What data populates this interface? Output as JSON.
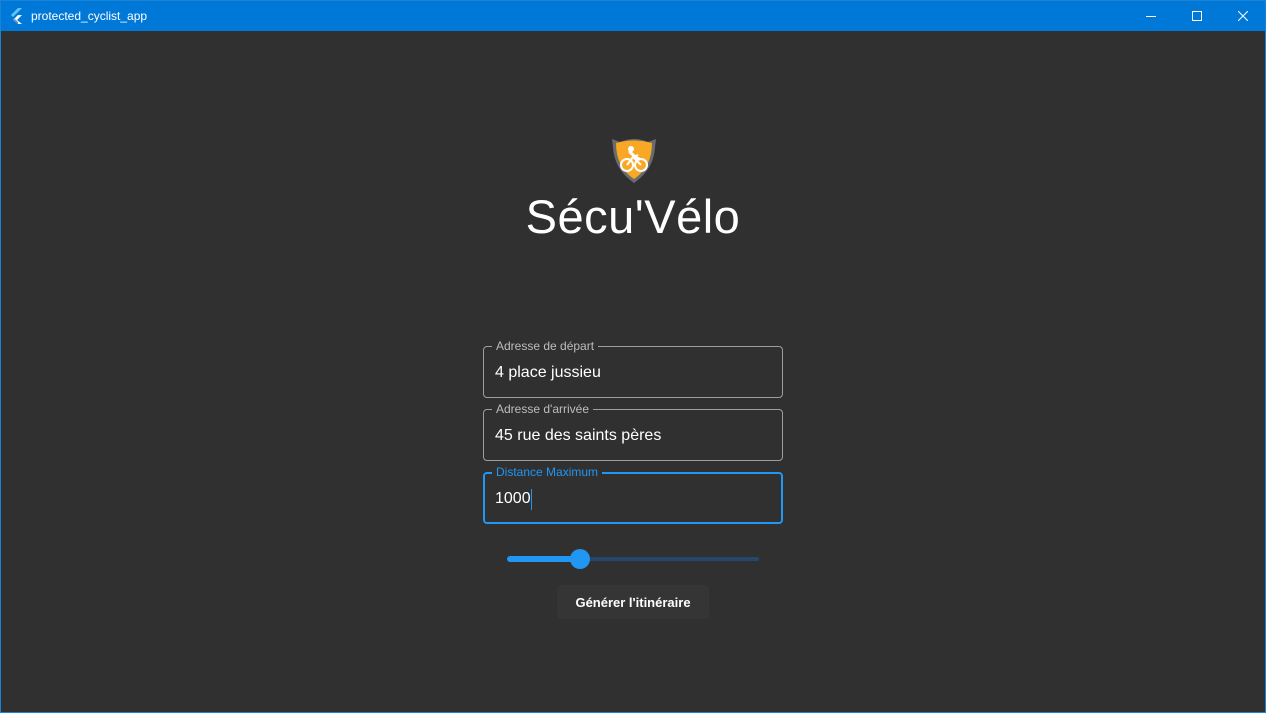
{
  "window": {
    "title": "protected_cyclist_app"
  },
  "colors": {
    "titlebar": "#0078d7",
    "background": "#303030",
    "accent": "#2196f3",
    "logo_orange": "#f9a825"
  },
  "icons": {
    "app": "flutter-logo-icon",
    "minimize": "minimize-icon",
    "maximize": "maximize-icon",
    "close": "close-icon",
    "logo": "cyclist-shield-icon"
  },
  "header": {
    "title": "Sécu'Vélo"
  },
  "form": {
    "start": {
      "label": "Adresse de départ",
      "value": "4 place jussieu"
    },
    "end": {
      "label": "Adresse d'arrivée",
      "value": "45 rue des saints pères"
    },
    "distance": {
      "label": "Distance Maximum",
      "value": "1000"
    },
    "slider": {
      "fraction": 0.29
    },
    "submit_label": "Générer l'itinéraire"
  }
}
